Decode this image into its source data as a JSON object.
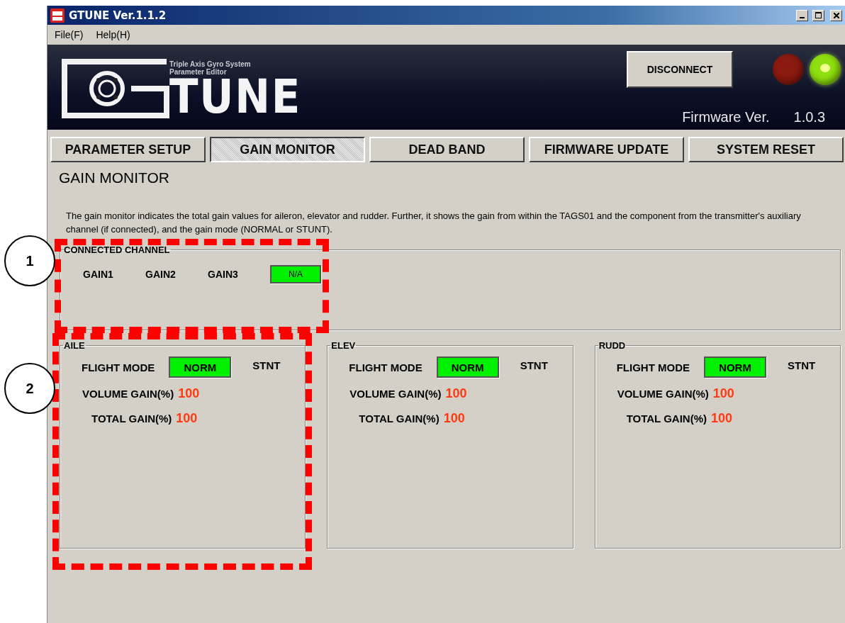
{
  "window": {
    "title": "GTUNE Ver.1.1.2"
  },
  "menu": [
    {
      "label": "File(F)"
    },
    {
      "label": "Help(H)"
    }
  ],
  "banner": {
    "subtitle_1": "Triple Axis Gyro System",
    "subtitle_2": "Parameter Editor",
    "logo_text": "TUNE",
    "button": "DISCONNECT",
    "leds": [
      {
        "color": "#8b1a10",
        "on": false
      },
      {
        "color": "#8fe010",
        "on": true
      }
    ],
    "firmware_label": "Firmware Ver.",
    "firmware_value": "1.0.3"
  },
  "tabs": [
    {
      "label": "PARAMETER SETUP",
      "selected": false
    },
    {
      "label": "GAIN MONITOR",
      "selected": true
    },
    {
      "label": "DEAD BAND",
      "selected": false
    },
    {
      "label": "FIRMWARE UPDATE",
      "selected": false
    },
    {
      "label": "SYSTEM RESET",
      "selected": false
    }
  ],
  "heading": "GAIN MONITOR",
  "description": "The gain monitor indicates the total gain values for aileron, elevator and rudder. Further, it shows the gain from within the TAGS01 and the component from the transmitter's auxiliary channel (if connected), and the gain mode (NORMAL or STUNT).",
  "connected_channel": {
    "title": "CONNECTED CHANNEL",
    "options": [
      {
        "label": "GAIN1",
        "active": false
      },
      {
        "label": "GAIN2",
        "active": false
      },
      {
        "label": "GAIN3",
        "active": false
      },
      {
        "label": "N/A",
        "active": true
      }
    ]
  },
  "axes": [
    {
      "title": "AILE",
      "mode_label": "FLIGHT MODE",
      "modes": [
        {
          "label": "NORM",
          "active": true
        },
        {
          "label": "STNT",
          "active": false
        }
      ],
      "volume_label": "VOLUME GAIN(%)",
      "volume_value": "100",
      "total_label": "TOTAL GAIN(%)",
      "total_value": "100"
    },
    {
      "title": "ELEV",
      "mode_label": "FLIGHT MODE",
      "modes": [
        {
          "label": "NORM",
          "active": true
        },
        {
          "label": "STNT",
          "active": false
        }
      ],
      "volume_label": "VOLUME GAIN(%)",
      "volume_value": "100",
      "total_label": "TOTAL GAIN(%)",
      "total_value": "100"
    },
    {
      "title": "RUDD",
      "mode_label": "FLIGHT MODE",
      "modes": [
        {
          "label": "NORM",
          "active": true
        },
        {
          "label": "STNT",
          "active": false
        }
      ],
      "volume_label": "VOLUME GAIN(%)",
      "volume_value": "100",
      "total_label": "TOTAL GAIN(%)",
      "total_value": "100"
    }
  ],
  "callouts": [
    {
      "label": "1"
    },
    {
      "label": "2"
    }
  ]
}
